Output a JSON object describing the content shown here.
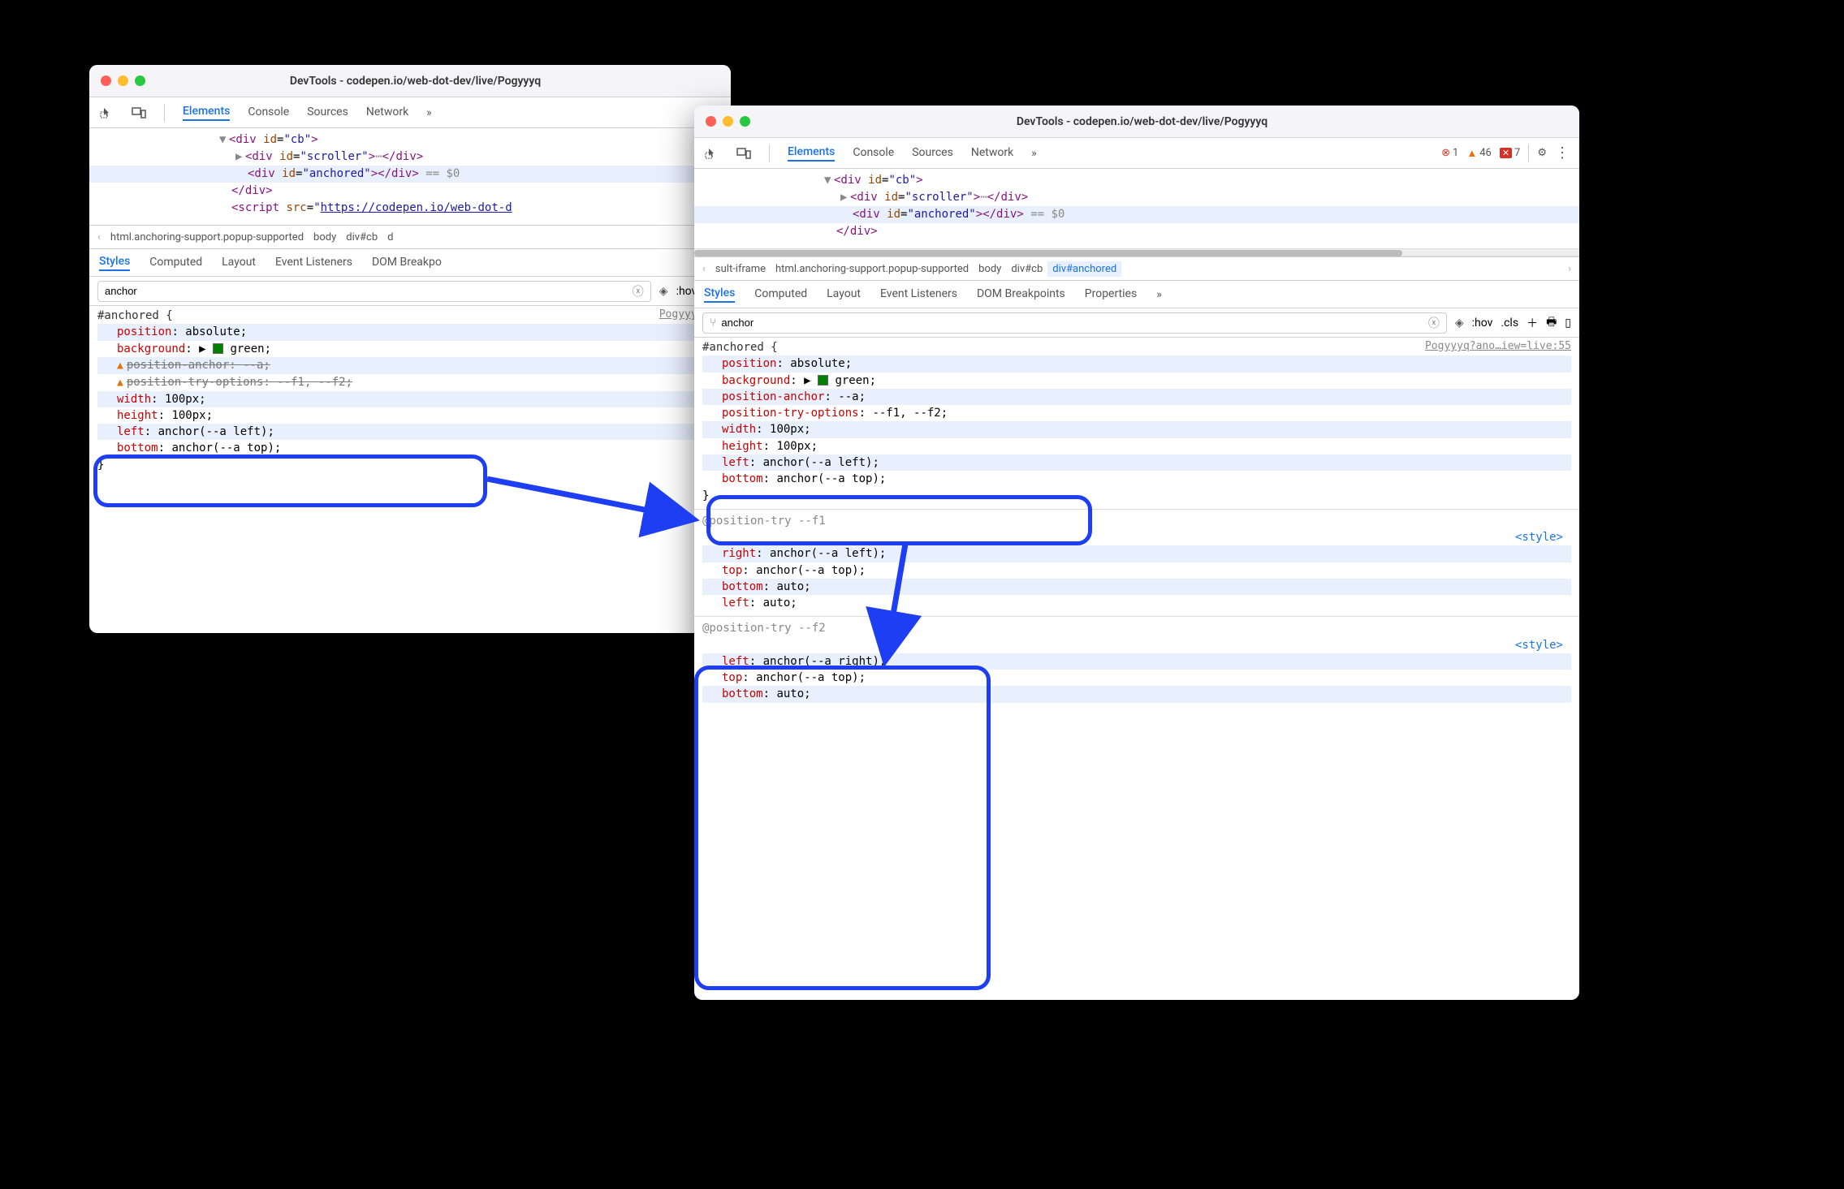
{
  "title_left": "DevTools - codepen.io/web-dot-dev/live/Pogyyyq",
  "title_right": "DevTools - codepen.io/web-dot-dev/live/Pogyyyq",
  "tabs": {
    "elements": "Elements",
    "console": "Console",
    "sources": "Sources",
    "network": "Network"
  },
  "errors": {
    "x": "1",
    "warn": "46",
    "info": "7"
  },
  "elements": {
    "l1": "<div id=\"cb\">",
    "l2_open": "<div id=\"scroller\">",
    "l2_ell": "…",
    "l2_close": "</div>",
    "l3_open": "<div id=\"anchored\">",
    "l3_close": "</div>",
    "l3_eq": " == $0",
    "l4": "</div>",
    "l5a": "<script src=\"",
    "l5b": "https://codepen.io/web-dot-d",
    "r4": "</div>"
  },
  "bc_left": [
    "html.anchoring-support.popup-supported",
    "body",
    "div#cb"
  ],
  "bc_right": [
    "sult-iframe",
    "html.anchoring-support.popup-supported",
    "body",
    "div#cb",
    "div#anchored"
  ],
  "subtabs": {
    "styles": "Styles",
    "computed": "Computed",
    "layout": "Layout",
    "events": "Event Listeners",
    "dom": "DOM Breakpoints",
    "props": "Properties"
  },
  "filter_left": "anchor",
  "filter_right": "anchor",
  "toolbar_extra": {
    "hov": ":hov",
    "cls": ".cls"
  },
  "source_left": "Pogyyyq?an",
  "source_right": "Pogyyyq?ano…iew=live:55",
  "css": {
    "selector": "#anchored {",
    "position": "position",
    "position_v": "absolute",
    "background": "background",
    "background_v": "green",
    "pos_anchor": "position-anchor",
    "pos_anchor_v": "--a",
    "pos_try": "position-try-options",
    "pos_try_v": "--f1, --f2",
    "width": "width",
    "width_v": "100px",
    "height": "height",
    "height_v": "100px",
    "left": "left",
    "left_v": "anchor(--a left)",
    "bottom": "bottom",
    "bottom_v": "anchor(--a top)",
    "close": "}"
  },
  "ptry1": {
    "head": "@position-try --f1",
    "right": "right",
    "right_v": "anchor(--a left)",
    "top": "top",
    "top_v": "anchor(--a top)",
    "bottom": "bottom",
    "bottom_v": "auto",
    "left": "left",
    "left_v": "auto"
  },
  "ptry2": {
    "head": "@position-try --f2",
    "left": "left",
    "left_v": "anchor(--a right)",
    "top": "top",
    "top_v": "anchor(--a top)",
    "bottom": "bottom",
    "bottom_v": "auto"
  },
  "stylelink": "<style>"
}
